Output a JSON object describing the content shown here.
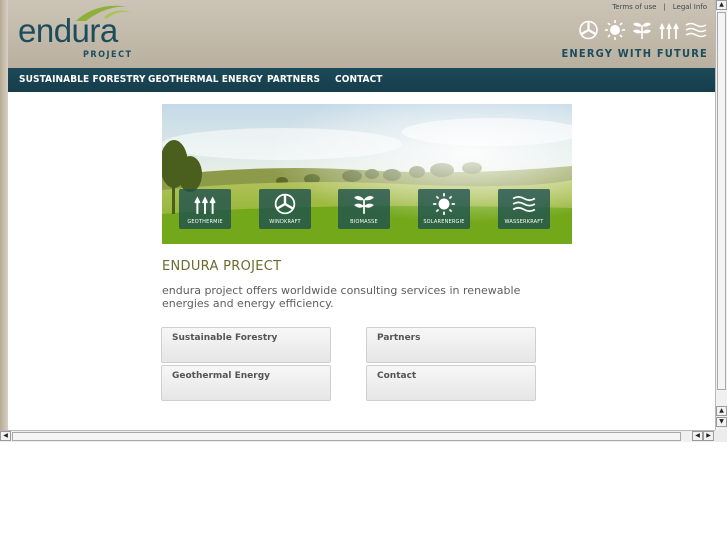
{
  "header": {
    "logo_text": "endura",
    "logo_sub": "PROJECT",
    "tagline": "ENERGY WITH FUTURE",
    "top_links": [
      "Terms of use",
      "Legal Info"
    ],
    "top_sep": "|",
    "icons": [
      "windmill-icon",
      "sun-icon",
      "plant-icon",
      "geothermal-icon",
      "water-icon"
    ]
  },
  "nav": {
    "items": [
      "SUSTAINABLE FORESTRY",
      "GEOTHERMAL ENERGY",
      "PARTNERS",
      "CONTACT"
    ]
  },
  "hero": {
    "buttons": [
      "GEOTHERMIE",
      "WINDKRAFT",
      "BIOMASSE",
      "SOLARENERGIE",
      "WASSERKRAFT"
    ]
  },
  "main": {
    "title": "ENDURA PROJECT",
    "text": "endura project offers worldwide consulting services in renewable energies and energy efficiency."
  },
  "links": [
    "Sustainable Forestry",
    "Partners",
    "Geothermal Energy",
    "Contact"
  ],
  "colors": {
    "header_bg": "#c3baaa",
    "nav_bg": "#1c4a5a",
    "brand": "#1d4d5c",
    "title": "#6b6b30",
    "hero_button": "#1b4e4e"
  }
}
